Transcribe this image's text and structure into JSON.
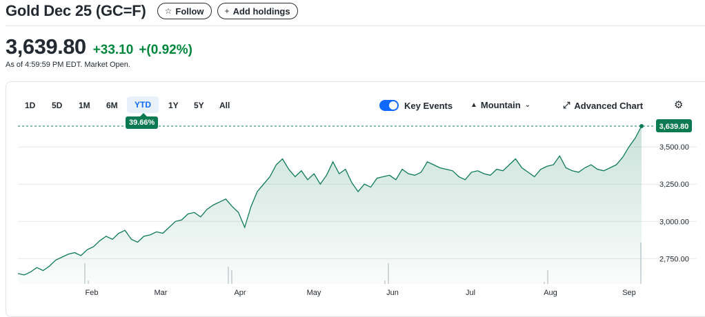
{
  "header": {
    "title": "Gold Dec 25 (GC=F)",
    "follow_icon": "star-outline-icon",
    "follow_label": "Follow",
    "add_icon": "plus-icon",
    "add_label": "Add holdings"
  },
  "quote": {
    "price": "3,639.80",
    "change": "+33.10",
    "change_pct": "+(0.92%)",
    "as_of": "As of 4:59:59 PM EDT. Market Open.",
    "up_color": "#00873c"
  },
  "ranges": [
    "1D",
    "5D",
    "1M",
    "6M",
    "YTD",
    "1Y",
    "5Y",
    "All"
  ],
  "active_range": "YTD",
  "ytd_return": "39.66%",
  "controls": {
    "key_events_label": "Key Events",
    "key_events_on": true,
    "chart_type_icon": "mountain-icon",
    "chart_type_label": "Mountain",
    "chevron_icon": "chevron-down-icon",
    "advanced_icon": "expand-arrows-icon",
    "advanced_label": "Advanced Chart",
    "settings_icon": "gear-icon"
  },
  "chart_data": {
    "type": "area",
    "x_months": [
      "Feb",
      "Mar",
      "Apr",
      "May",
      "Jun",
      "Jul",
      "Aug",
      "Sep"
    ],
    "y_ticks": [
      "3,500.00",
      "3,250.00",
      "3,000.00",
      "2,750.00"
    ],
    "y_tick_values": [
      3500,
      3250,
      3000,
      2750
    ],
    "last_price_label": "3,639.80",
    "last_price": 3639.8,
    "line_color": "#0b7a52",
    "grid": true,
    "series": [
      {
        "values": [
          2650,
          2640,
          2660,
          2690,
          2670,
          2700,
          2740,
          2760,
          2780,
          2790,
          2770,
          2810,
          2830,
          2870,
          2900,
          2880,
          2920,
          2940,
          2880,
          2860,
          2900,
          2910,
          2930,
          2920,
          2960,
          3000,
          3010,
          3050,
          3060,
          3030,
          3080,
          3110,
          3130,
          3150,
          3100,
          3060,
          2960,
          3100,
          3200,
          3250,
          3300,
          3380,
          3420,
          3350,
          3300,
          3340,
          3280,
          3320,
          3250,
          3310,
          3400,
          3320,
          3350,
          3260,
          3200,
          3250,
          3230,
          3290,
          3300,
          3310,
          3280,
          3350,
          3320,
          3310,
          3330,
          3400,
          3380,
          3360,
          3350,
          3340,
          3300,
          3280,
          3330,
          3340,
          3320,
          3310,
          3350,
          3340,
          3380,
          3420,
          3360,
          3330,
          3300,
          3350,
          3370,
          3380,
          3440,
          3360,
          3340,
          3330,
          3360,
          3380,
          3350,
          3340,
          3360,
          3380,
          3430,
          3500,
          3560,
          3639.8
        ]
      }
    ],
    "volume_bars": [
      0.3,
      0.05,
      0.25,
      0.2,
      0.05,
      0.3,
      0.03,
      0.2,
      0.6
    ]
  }
}
